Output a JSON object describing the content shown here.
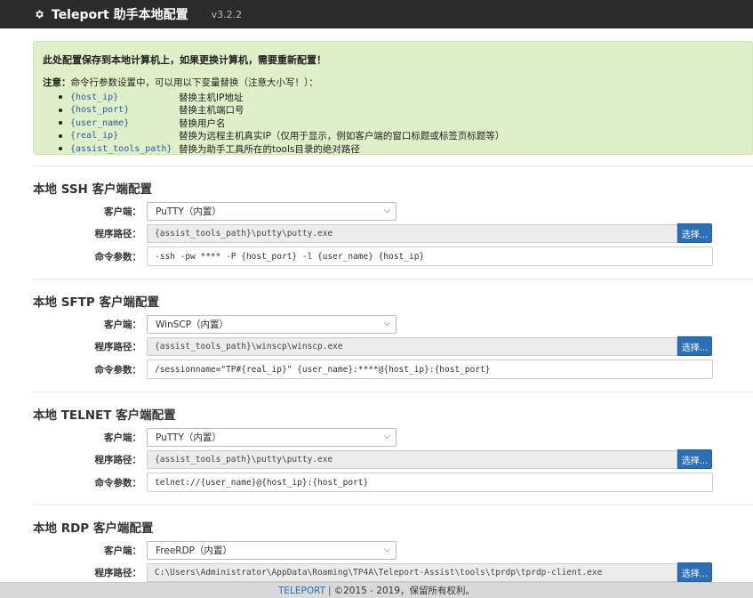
{
  "header": {
    "title": "Teleport 助手本地配置",
    "version": "v3.2.2",
    "icon": "gear-icon"
  },
  "notice": {
    "headline": "此处配置保存到本地计算机上，如果更换计算机，需要重新配置！",
    "note_label": "注意：",
    "note_text": "命令行参数设置中，可以用以下变量替换（注意大小写！）：",
    "vars": [
      {
        "name": "{host_ip}",
        "desc": "替换主机IP地址"
      },
      {
        "name": "{host_port}",
        "desc": "替换主机端口号"
      },
      {
        "name": "{user_name}",
        "desc": "替换用户名"
      },
      {
        "name": "{real_ip}",
        "desc": "替换为远程主机真实IP（仅用于显示，例如客户端的窗口标题或标签页标题等）"
      },
      {
        "name": "{assist_tools_path}",
        "desc": "替换为助手工具所在的tools目录的绝对路径"
      }
    ]
  },
  "labels": {
    "client": "客户端：",
    "path": "程序路径：",
    "args": "命令参数：",
    "choose": "选择..."
  },
  "sections": [
    {
      "title": "本地 SSH 客户端配置",
      "client": "PuTTY（内置）",
      "path": "{assist_tools_path}\\putty\\putty.exe",
      "args": "-ssh -pw **** -P {host_port} -l {user_name} {host_ip}"
    },
    {
      "title": "本地 SFTP 客户端配置",
      "client": "WinSCP（内置）",
      "path": "{assist_tools_path}\\winscp\\winscp.exe",
      "args": "/sessionname=\"TP#{real_ip}\" {user_name}:****@{host_ip}:{host_port}"
    },
    {
      "title": "本地 TELNET 客户端配置",
      "client": "PuTTY（内置）",
      "path": "{assist_tools_path}\\putty\\putty.exe",
      "args": "telnet://{user_name}@{host_ip}:{host_port}"
    },
    {
      "title": "本地 RDP 客户端配置",
      "client": "FreeRDP（内置）",
      "path": "C:\\Users\\Administrator\\AppData\\Roaming\\TP4A\\Teleport-Assist\\tools\\tprdp\\tprdp-client.exe"
    }
  ],
  "footer": {
    "brand": "TELEPORT",
    "separator": "|",
    "copyright": "©2015 - 2019，保留所有权利。"
  }
}
